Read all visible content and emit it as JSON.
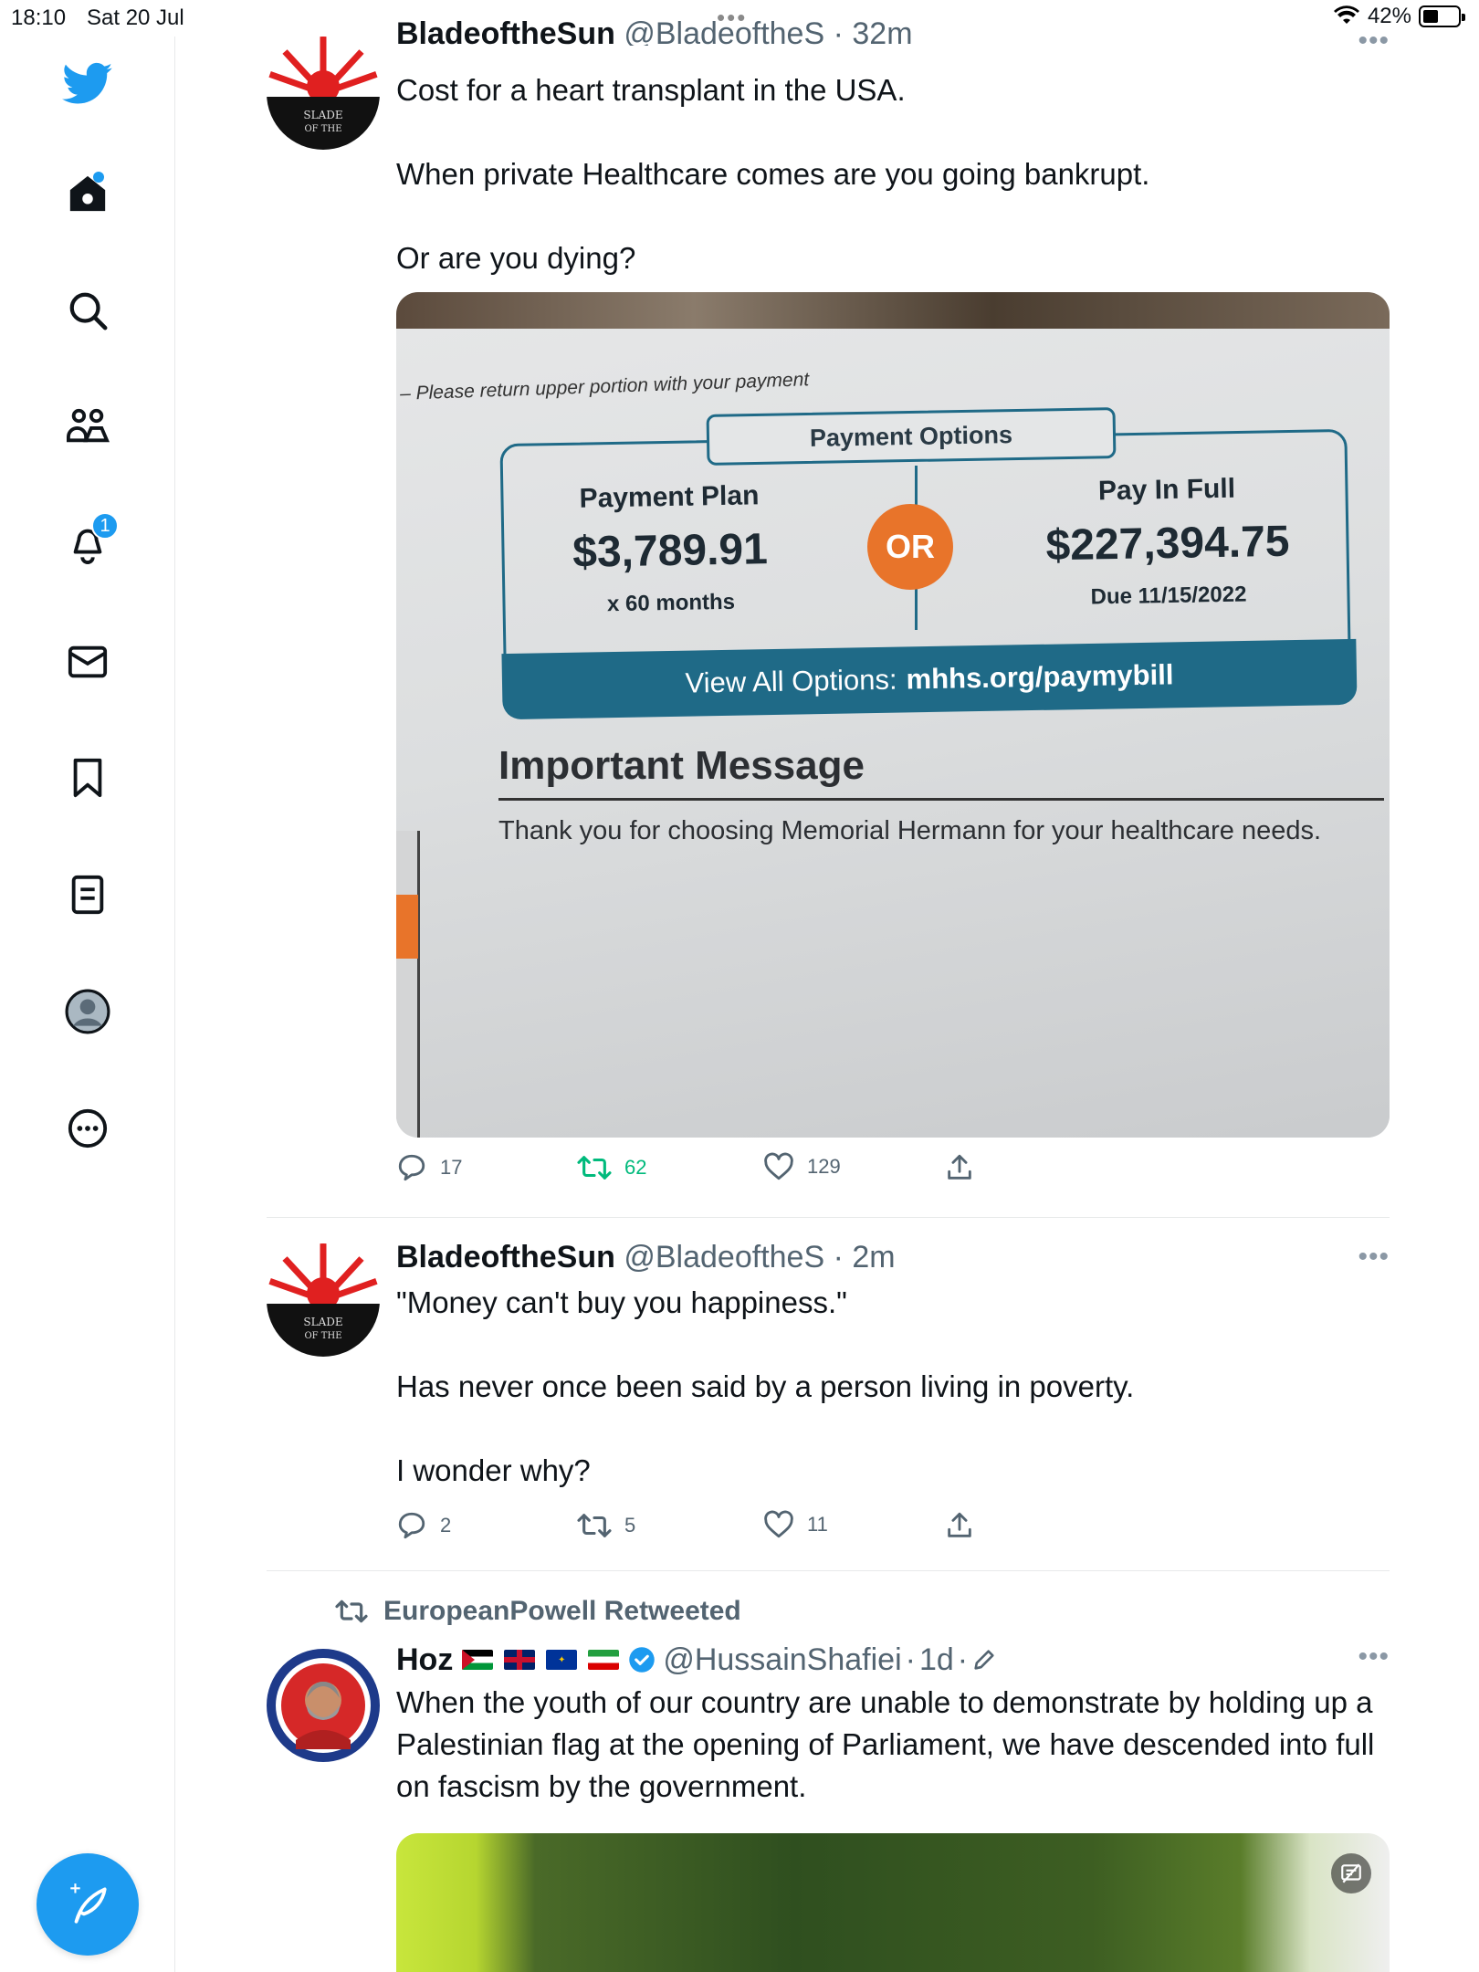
{
  "status_bar": {
    "time": "18:10",
    "date": "Sat 20 Jul",
    "battery": "42%"
  },
  "sidebar": {
    "notifications_badge": "1",
    "items": [
      "home",
      "explore",
      "communities",
      "notifications",
      "messages",
      "bookmarks",
      "lists",
      "profile",
      "more"
    ]
  },
  "tweets": [
    {
      "name": "BladeoftheSun",
      "handle": "@BladeoftheS",
      "time": "32m",
      "lines": [
        "Cost for a heart transplant in the USA.",
        "When private Healthcare comes are you going bankrupt.",
        "Or are you dying?"
      ],
      "media": {
        "return_note": "– Please return upper portion with your payment",
        "options_title": "Payment Options",
        "plan_label": "Payment Plan",
        "plan_amount": "$3,789.91",
        "plan_term": "x 60 months",
        "or": "OR",
        "full_label": "Pay In Full",
        "full_amount": "$227,394.75",
        "due": "Due 11/15/2022",
        "view_all": "View All Options:",
        "url": "mhhs.org/paymybill",
        "important_title": "Important Message",
        "important_msg": "Thank you for choosing Memorial Hermann for your healthcare needs."
      },
      "replies": "17",
      "retweets": "62",
      "likes": "129"
    },
    {
      "name": "BladeoftheSun",
      "handle": "@BladeoftheS",
      "time": "2m",
      "lines": [
        "\"Money can't buy you happiness.\"",
        "Has never once been said by a person living in poverty.",
        "I wonder why?"
      ],
      "replies": "2",
      "retweets": "5",
      "likes": "11"
    },
    {
      "retweeted_by": "EuropeanPowell Retweeted",
      "name": "Hoz",
      "handle": "@HussainShafiei",
      "time": "1d",
      "text": "When the youth of our country are unable to demonstrate by holding up a Palestinian flag at the opening of Parliament, we have descended into full on fascism by the government."
    }
  ],
  "colors": {
    "accent": "#1d9bf0",
    "retweet": "#00ba7c",
    "muted": "#536471"
  }
}
